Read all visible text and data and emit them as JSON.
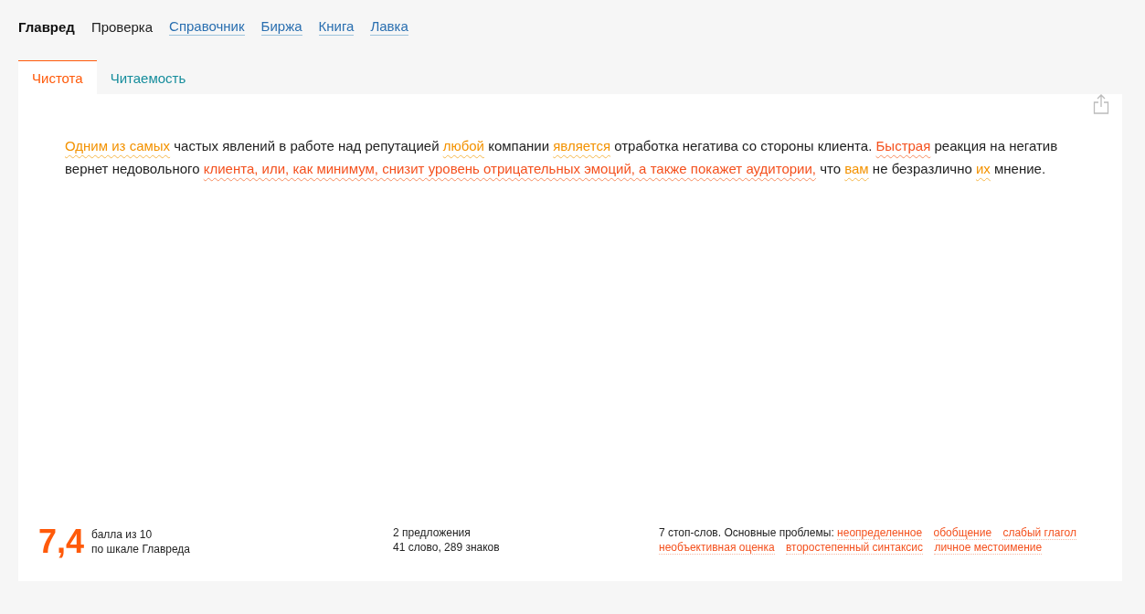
{
  "nav": [
    {
      "label": "Главред",
      "kind": "current"
    },
    {
      "label": "Проверка",
      "kind": "plain"
    },
    {
      "label": "Справочник",
      "kind": "link"
    },
    {
      "label": "Биржа",
      "kind": "link"
    },
    {
      "label": "Книга",
      "kind": "link"
    },
    {
      "label": "Лавка",
      "kind": "link"
    }
  ],
  "tabs": [
    {
      "label": "Чистота",
      "selected": true
    },
    {
      "label": "Читаемость",
      "selected": false
    }
  ],
  "text": [
    {
      "text": "Одним из самых",
      "kind": "stop"
    },
    {
      "text": " частых явлений в работе над репутацией ",
      "kind": "plain"
    },
    {
      "text": "любой",
      "kind": "stop"
    },
    {
      "text": " компании ",
      "kind": "plain"
    },
    {
      "text": "является",
      "kind": "stop"
    },
    {
      "text": " отработка негатива со стороны клиента. ",
      "kind": "plain"
    },
    {
      "text": "Быстрая",
      "kind": "error"
    },
    {
      "text": " реакция на негатив вернет недовольного ",
      "kind": "plain"
    },
    {
      "text": "клиента, или, как минимум, снизит уровень отрицательных эмоций, а также покажет аудитории,",
      "kind": "error"
    },
    {
      "text": " что ",
      "kind": "plain"
    },
    {
      "text": "вам",
      "kind": "stop"
    },
    {
      "text": " не безразлично ",
      "kind": "plain"
    },
    {
      "text": "их",
      "kind": "stop"
    },
    {
      "text": " мнение.",
      "kind": "plain"
    }
  ],
  "score": {
    "value": "7,4",
    "line_1": "балла из 10",
    "line_2": "по шкале Главреда"
  },
  "stats": [
    "2 предложения",
    "41 слово, 289 знаков"
  ],
  "problems": {
    "intro": "7 стоп-слов. Основные проблемы:",
    "items": [
      "неопределенное",
      "обобщение",
      "слабый глагол",
      "необъективная оценка",
      "второстепенный синтаксис",
      "личное местоимение"
    ]
  }
}
